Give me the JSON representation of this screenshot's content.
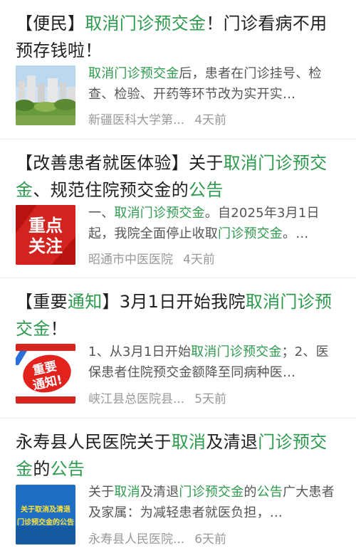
{
  "results": [
    {
      "title_parts": [
        {
          "t": "【便民】",
          "hl": false
        },
        {
          "t": "取消门诊预交金",
          "hl": true
        },
        {
          "t": "！门诊看病不用预存钱啦！",
          "hl": false
        }
      ],
      "snippet_parts": [
        {
          "t": "取消门诊预交金",
          "hl": true
        },
        {
          "t": "后，患者在门诊挂号、检查、检验、开药等环节改为实开实…",
          "hl": false
        }
      ],
      "source": "新疆医科大学第...",
      "time": "4天前",
      "thumb": "campus-photo"
    },
    {
      "title_parts": [
        {
          "t": "【改善患者就医体验】关于",
          "hl": false
        },
        {
          "t": "取消门诊预交金",
          "hl": true
        },
        {
          "t": "、规范住院预交金的",
          "hl": false
        },
        {
          "t": "公告",
          "hl": true
        }
      ],
      "snippet_parts": [
        {
          "t": "一、",
          "hl": false
        },
        {
          "t": "取消门诊预交金",
          "hl": true
        },
        {
          "t": "。自2025年3月1日起，我院全面停止收取",
          "hl": false
        },
        {
          "t": "门诊预交金",
          "hl": true
        },
        {
          "t": "。…",
          "hl": false
        }
      ],
      "source": "昭通市中医医院",
      "time": "4天前",
      "thumb": "重点关注"
    },
    {
      "title_parts": [
        {
          "t": "【重要",
          "hl": false
        },
        {
          "t": "通知",
          "hl": true
        },
        {
          "t": "】3月1日开始我院",
          "hl": false
        },
        {
          "t": "取消门诊预交金",
          "hl": true
        },
        {
          "t": "！",
          "hl": false
        }
      ],
      "snippet_parts": [
        {
          "t": "1、从3月1日开始",
          "hl": false
        },
        {
          "t": "取消门诊预交金",
          "hl": true
        },
        {
          "t": "；2、医保患者住院预交金额降至同病种医…",
          "hl": false
        }
      ],
      "source": "峡江县总医院县...",
      "time": "5天前",
      "thumb": "重要通知!"
    },
    {
      "title_parts": [
        {
          "t": "永寿县人民医院关于",
          "hl": false
        },
        {
          "t": "取消",
          "hl": true
        },
        {
          "t": "及清退",
          "hl": false
        },
        {
          "t": "门诊预交金",
          "hl": true
        },
        {
          "t": "的",
          "hl": false
        },
        {
          "t": "公告",
          "hl": true
        }
      ],
      "snippet_parts": [
        {
          "t": "关于",
          "hl": false
        },
        {
          "t": "取消",
          "hl": true
        },
        {
          "t": "及清退",
          "hl": false
        },
        {
          "t": "门诊预交金",
          "hl": true
        },
        {
          "t": "的",
          "hl": false
        },
        {
          "t": "公告",
          "hl": true
        },
        {
          "t": "广大患者及家属：为减轻患者就医负担，…",
          "hl": false
        }
      ],
      "source": "永寿县人民医院...",
      "time": "6天前",
      "thumb": "关于取消及清退门诊预交金的公告"
    }
  ],
  "colors": {
    "highlight": "#2e9a4e",
    "meta": "#999999",
    "text": "#1f1f1f"
  }
}
